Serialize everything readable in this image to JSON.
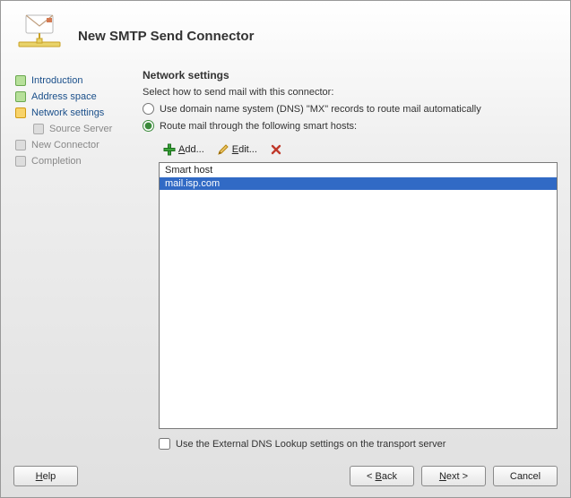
{
  "header": {
    "title": "New SMTP Send Connector"
  },
  "sidebar": {
    "items": [
      {
        "label": "Introduction",
        "state": "done"
      },
      {
        "label": "Address space",
        "state": "done"
      },
      {
        "label": "Network settings",
        "state": "current"
      },
      {
        "label": "Source Server",
        "state": "pending",
        "child": true
      },
      {
        "label": "New Connector",
        "state": "pending"
      },
      {
        "label": "Completion",
        "state": "pending"
      }
    ]
  },
  "content": {
    "title": "Network settings",
    "instruction": "Select how to send mail with this connector:",
    "radios": {
      "dns_label": "Use domain name system (DNS) \"MX\" records to route mail automatically",
      "smarthost_label": "Route mail through the following smart hosts:",
      "selected": "smarthost"
    },
    "toolbar": {
      "add_prefix": "A",
      "add_rest": "dd...",
      "edit_prefix": "E",
      "edit_rest": "dit...",
      "delete_name": "delete-button"
    },
    "list": {
      "header": "Smart host",
      "rows": [
        {
          "value": "mail.isp.com",
          "selected": true
        }
      ]
    },
    "external_dns": {
      "label_prefix": "Use the Exte",
      "label_r": "r",
      "label_suffix": "nal DNS Lookup settings on the transport server",
      "checked": false
    }
  },
  "footer": {
    "help_u": "H",
    "help_rest": "elp",
    "back_prefix": "< ",
    "back_u": "B",
    "back_rest": "ack",
    "next_u": "N",
    "next_rest": "ext >",
    "cancel": "Cancel"
  }
}
